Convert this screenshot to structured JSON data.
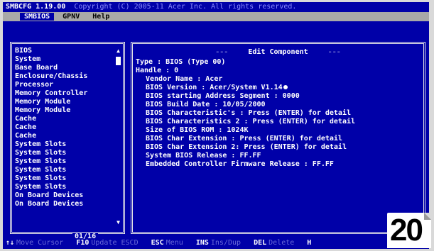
{
  "titlebar": {
    "title": "SMBCFG 1.19.00",
    "copyright": "Copyright (C) 2005-11 Acer Inc. All rights reserved."
  },
  "menu": {
    "items": [
      "SMBIOS",
      "GPNV",
      "Help"
    ]
  },
  "left_list": {
    "items": [
      "BIOS",
      "System",
      "Base Board",
      "Enclosure/Chassis",
      "Processor",
      "Memory Controller",
      "Memory Module",
      "Memory Module",
      "Cache",
      "Cache",
      "Cache",
      "System Slots",
      "System Slots",
      "System Slots",
      "System Slots",
      "System Slots",
      "System Slots",
      "On Board Devices",
      "On Board Devices"
    ],
    "page": "01/16"
  },
  "edit_panel": {
    "header_left": "---",
    "header": "Edit Component",
    "header_right": "---",
    "lines": [
      {
        "indent": 1,
        "text": "Type : BIOS (Type 00)"
      },
      {
        "indent": 1,
        "text": "Handle : 0"
      },
      {
        "indent": 2,
        "text": "Vendor Name : Acer"
      },
      {
        "indent": 2,
        "text": "BIOS Version : Acer/System V1.14"
      },
      {
        "indent": 2,
        "text": "BIOS starting Address Segment : 0000"
      },
      {
        "indent": 2,
        "text": "BIOS Build Date : 10/05/2000"
      },
      {
        "indent": 2,
        "text": "BIOS Characteristic's : Press (ENTER) for detail"
      },
      {
        "indent": 2,
        "text": "BIOS Characteristics 2 : Press (ENTER) for detail"
      },
      {
        "indent": 2,
        "text": "Size of BIOS ROM : 1024K"
      },
      {
        "indent": 2,
        "text": "BIOS Char Extension : Press (ENTER) for detail"
      },
      {
        "indent": 2,
        "text": "BIOS Char Extension 2: Press (ENTER) for detail"
      },
      {
        "indent": 2,
        "text": "System BIOS Release : FF.FF"
      },
      {
        "indent": 2,
        "text": "Embedded Controller Firmware Release : FF.FF"
      }
    ]
  },
  "statusbar": {
    "items": [
      {
        "key": "↑↓",
        "desc": "Move Cursor"
      },
      {
        "key": "F10",
        "desc": "Update ESCD"
      },
      {
        "key": "ESC",
        "desc": "Menu"
      },
      {
        "key": "INS",
        "desc": "Ins/Dup"
      },
      {
        "key": "DEL",
        "desc": "Delete"
      },
      {
        "key": "H",
        "desc": ""
      }
    ]
  },
  "page_badge": "20",
  "colors": {
    "screen_bg": "#0000a8",
    "menu_bg": "#a8a8a8",
    "text": "#ffffff"
  }
}
